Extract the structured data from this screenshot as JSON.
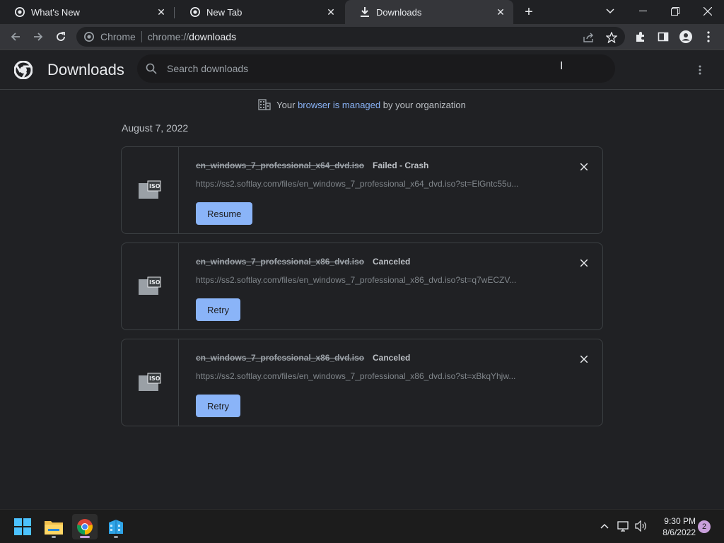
{
  "tabs": [
    {
      "label": "What's New",
      "icon": "chrome-icon"
    },
    {
      "label": "New Tab",
      "icon": "chrome-icon"
    },
    {
      "label": "Downloads",
      "icon": "download-icon",
      "active": true
    }
  ],
  "omnibox": {
    "site": "Chrome",
    "url_prefix": "chrome://",
    "url_host": "downloads"
  },
  "page": {
    "title": "Downloads",
    "search_placeholder": "Search downloads"
  },
  "managed": {
    "prefix": "Your",
    "link": "browser is managed",
    "suffix": "by your organization"
  },
  "date_group": "August 7, 2022",
  "downloads": [
    {
      "filename": "en_windows_7_professional_x64_dvd.iso",
      "status": "Failed - Crash",
      "url": "https://ss2.softlay.com/files/en_windows_7_professional_x64_dvd.iso?st=ElGntc55u...",
      "action": "Resume"
    },
    {
      "filename": "en_windows_7_professional_x86_dvd.iso",
      "status": "Canceled",
      "url": "https://ss2.softlay.com/files/en_windows_7_professional_x86_dvd.iso?st=q7wECZV...",
      "action": "Retry"
    },
    {
      "filename": "en_windows_7_professional_x86_dvd.iso",
      "status": "Canceled",
      "url": "https://ss2.softlay.com/files/en_windows_7_professional_x86_dvd.iso?st=xBkqYhjw...",
      "action": "Retry"
    }
  ],
  "taskbar": {
    "time": "9:30 PM",
    "date": "8/6/2022",
    "notification_count": "2"
  },
  "colors": {
    "accent": "#8ab4f8",
    "background": "#202124",
    "toolbar": "#35363a"
  }
}
